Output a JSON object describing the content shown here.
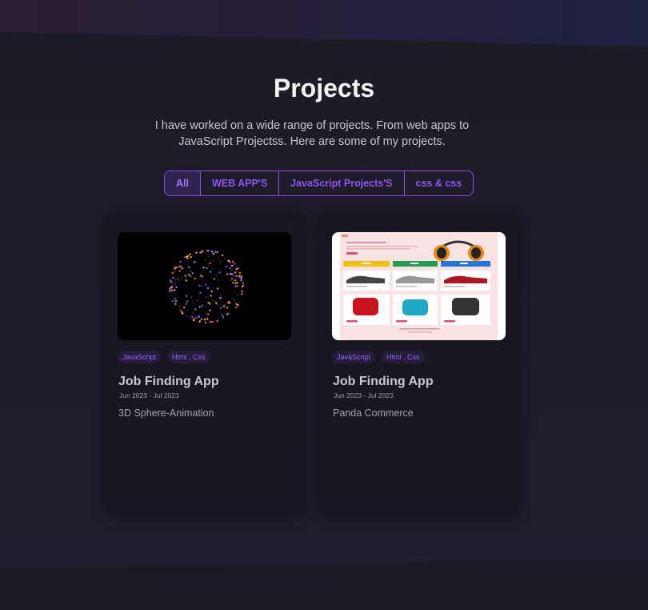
{
  "header": {
    "title": "Projects",
    "description": "I have worked on a wide range of projects. From web apps to JavaScript Projectss. Here are some of my projects."
  },
  "filters": {
    "tabs": [
      {
        "label": "All",
        "active": true
      },
      {
        "label": "WEB APP'S",
        "active": false
      },
      {
        "label": "JavaScript Projects'S",
        "active": false
      },
      {
        "label": "css & css",
        "active": false
      }
    ]
  },
  "projects": [
    {
      "tags": [
        "JavaScript",
        "Html , Css"
      ],
      "title": "Job Finding App",
      "date": "Jun 2023 - Jul 2023",
      "description": "3D Sphere-Animation",
      "image": "sphere-animation-thumbnail"
    },
    {
      "tags": [
        "JavaScript",
        "Html , Css"
      ],
      "title": "Job Finding App",
      "date": "Jun 2023 - Jul 2023",
      "description": "Panda Commerce",
      "image": "ecommerce-site-thumbnail"
    }
  ],
  "colors": {
    "accent": "#8a4ef0",
    "background": "#1c1b23",
    "card": "#18171f"
  }
}
